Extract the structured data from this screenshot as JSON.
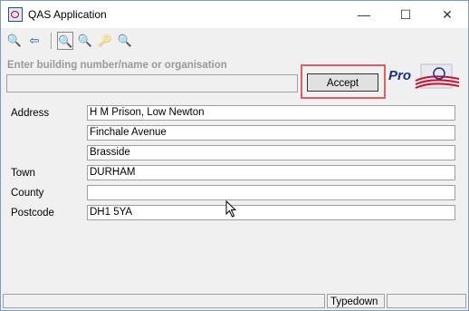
{
  "window": {
    "title": "QAS Application",
    "minimize_glyph": "—",
    "maximize_glyph": "☐",
    "close_glyph": "✕"
  },
  "toolbar": {
    "buttons": [
      {
        "icon": "search-new-icon",
        "glyph": "🔍"
      },
      {
        "icon": "back-arrow-icon",
        "glyph": "⇦"
      },
      {
        "icon": "search-refine-icon",
        "glyph": "🔍"
      },
      {
        "icon": "search-step-icon",
        "glyph": "🔍"
      },
      {
        "icon": "search-key-icon",
        "glyph": "🔑"
      },
      {
        "icon": "search-clear-icon",
        "glyph": "🔍"
      }
    ]
  },
  "search": {
    "prompt": "Enter building number/name or organisation",
    "value": "",
    "accept_label": "Accept"
  },
  "logo": {
    "text": "Pro"
  },
  "address": {
    "address_label": "Address",
    "line1": "H M Prison, Low Newton",
    "line2": "Finchale Avenue",
    "line3": "Brasside",
    "town_label": "Town",
    "town": "DURHAM",
    "county_label": "County",
    "county": "",
    "postcode_label": "Postcode",
    "postcode": "DH1 5YA"
  },
  "status": {
    "pane1": "",
    "mode": "Typedown",
    "pane3": ""
  },
  "colors": {
    "highlight": "#e06060",
    "logo_blue": "#1c2f8a",
    "logo_red": "#c8102e"
  }
}
